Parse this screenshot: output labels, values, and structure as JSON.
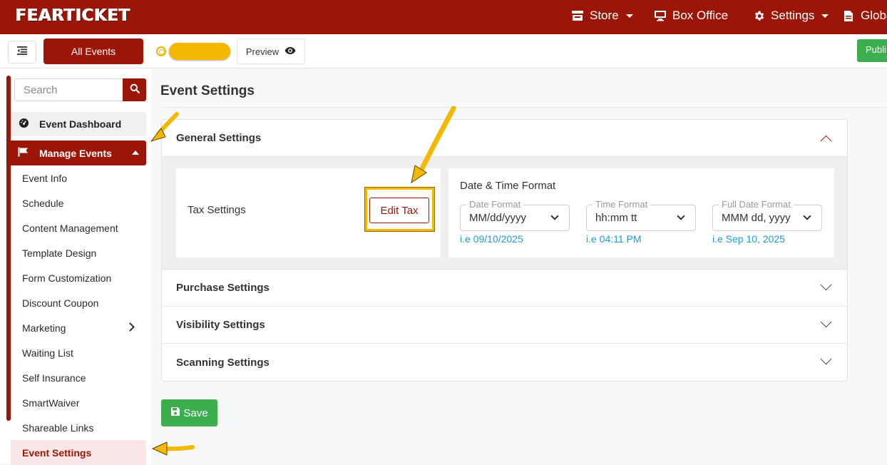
{
  "navbar": {
    "logo": "FEARTICKET",
    "store": "Store",
    "box_office": "Box Office",
    "settings": "Settings",
    "global": "Globa"
  },
  "toolbar": {
    "all_events": "All Events",
    "preview": "Preview",
    "publish": "Publi"
  },
  "sidebar": {
    "search_placeholder": "Search",
    "dashboard": "Event Dashboard",
    "manage_events": "Manage Events",
    "items": [
      {
        "label": "Event Info"
      },
      {
        "label": "Schedule"
      },
      {
        "label": "Content Management"
      },
      {
        "label": "Template Design"
      },
      {
        "label": "Form Customization"
      },
      {
        "label": "Discount Coupon"
      },
      {
        "label": "Marketing"
      },
      {
        "label": "Waiting List"
      },
      {
        "label": "Self Insurance"
      },
      {
        "label": "SmartWaiver"
      },
      {
        "label": "Shareable Links"
      },
      {
        "label": "Event Settings"
      }
    ]
  },
  "main": {
    "title": "Event Settings",
    "sections": {
      "general": "General Settings",
      "purchase": "Purchase Settings",
      "visibility": "Visibility Settings",
      "scanning": "Scanning Settings"
    },
    "tax": {
      "label": "Tax Settings",
      "button": "Edit Tax"
    },
    "datetime": {
      "title": "Date & Time Format",
      "date_label": "Date Format",
      "date_value": "MM/dd/yyyy",
      "date_example": "i.e 09/10/2025",
      "time_label": "Time Format",
      "time_value": "hh:mm tt",
      "time_example": "i.e 04:11 PM",
      "full_label": "Full Date Format",
      "full_value": "MMM dd, yyyy",
      "full_example": "i.e Sep 10, 2025"
    },
    "save": "Save"
  },
  "colors": {
    "brand": "#9c1608",
    "success": "#3dae4d",
    "annotation": "#f5b800",
    "link": "#1e9ae0"
  },
  "icons": [
    "store-icon",
    "monitor-icon",
    "gear-icon",
    "document-icon",
    "menu-toggle-icon",
    "eye-icon",
    "search-icon",
    "dashboard-icon",
    "flag-icon",
    "save-icon"
  ]
}
